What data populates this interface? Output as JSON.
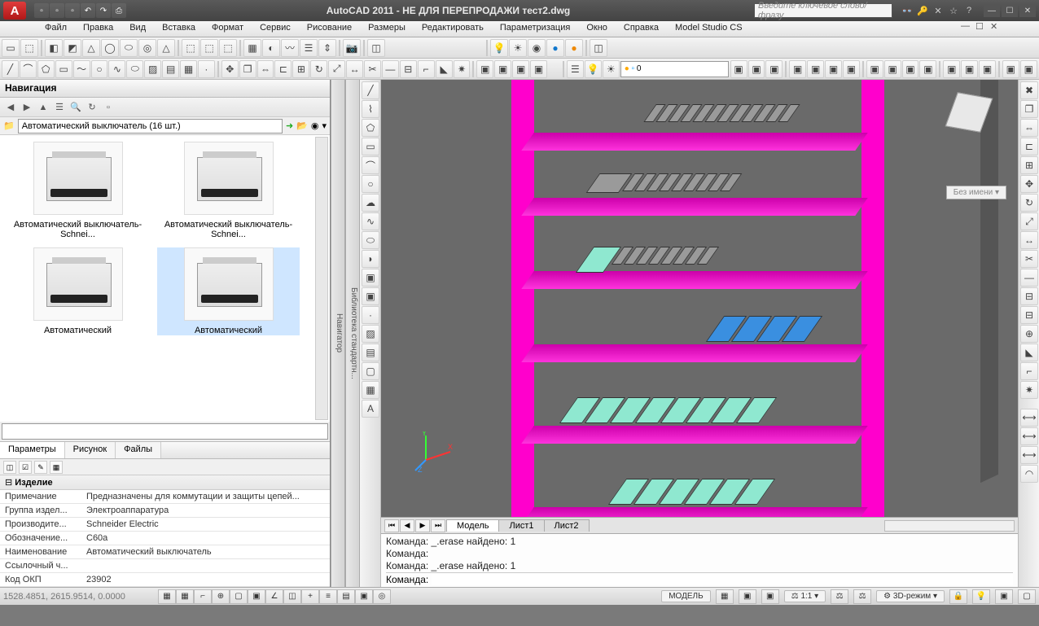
{
  "title": "AutoCAD 2011 - НЕ ДЛЯ ПЕРЕПРОДАЖИ   тест2.dwg",
  "search_placeholder": "Введите ключевое слово/фразу",
  "menu": [
    "Файл",
    "Правка",
    "Вид",
    "Вставка",
    "Формат",
    "Сервис",
    "Рисование",
    "Размеры",
    "Редактировать",
    "Параметризация",
    "Окно",
    "Справка",
    "Model Studio CS"
  ],
  "layer_combo": "0",
  "palettes": {
    "left1": "Навигатор",
    "left2": "Библиотека стандартн..."
  },
  "nav": {
    "title": "Навигация",
    "breadcrumb": "Автоматический выключатель (16 шт.)",
    "items": [
      "Автоматический выключатель-Schnei...",
      "Автоматический выключатель-Schnei...",
      "Автоматический",
      "Автоматический"
    ]
  },
  "param_tabs": [
    "Параметры",
    "Рисунок",
    "Файлы"
  ],
  "product": {
    "section": "Изделие",
    "rows": [
      {
        "k": "Примечание",
        "v": "Предназначены для коммутации и  защиты цепей..."
      },
      {
        "k": "Группа издел...",
        "v": "Электроаппаратура"
      },
      {
        "k": "Производите...",
        "v": "Schneider Electric"
      },
      {
        "k": "Обозначение...",
        "v": "C60a"
      },
      {
        "k": "Наименование",
        "v": "Автоматический выключатель"
      },
      {
        "k": "Ссылочный ч...",
        "v": ""
      },
      {
        "k": "Код ОКП",
        "v": "23902"
      }
    ]
  },
  "viewport_label": "Без имени",
  "model_tabs": [
    "Модель",
    "Лист1",
    "Лист2"
  ],
  "cmd_history": [
    "Команда: _.erase найдено: 1",
    "Команда:",
    "Команда: _.erase найдено: 1"
  ],
  "cmd_prompt": "Команда:",
  "status": {
    "coords": "1528.4851, 2615.9514, 0.0000",
    "model_btn": "МОДЕЛЬ",
    "scale": "1:1",
    "mode3d": "3D-режим"
  }
}
